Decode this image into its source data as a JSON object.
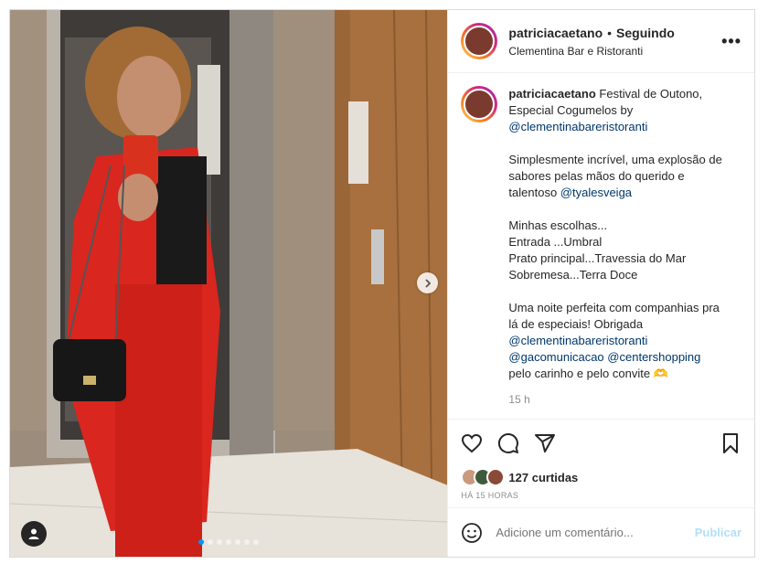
{
  "post": {
    "username": "patriciacaetano",
    "separator": "•",
    "follow_status": "Seguindo",
    "location": "Clementina Bar e Ristoranti",
    "caption": {
      "title": "Festival de Outono, Especial Cogumelos by",
      "mention1": "@clementinabareristoranti",
      "p2_text": "Simplesmente incrível, uma explosão de sabores pelas mãos do querido e talentoso",
      "p2_mention": "@tyalesveiga",
      "p3_line1": "Minhas escolhas...",
      "p3_line2": "Entrada ...Umbral",
      "p3_line3": "Prato principal...Travessia do Mar",
      "p3_line4": "Sobremesa...Terra Doce",
      "p4_text": "Uma noite perfeita com companhias pra lá de especiais! Obrigada",
      "p4_mention1": "@clementinabareristoranti",
      "p4_mention2": "@gacomunicacao",
      "p4_mention3": "@centershopping",
      "p4_end": "pelo carinho e pelo convite 🫶",
      "time": "15 h"
    },
    "likes_label": "127 curtidas",
    "posted_ago": "HÁ 15 HORAS",
    "comment_placeholder": "Adicione um comentário...",
    "publish_label": "Publicar",
    "carousel": {
      "count": 7,
      "active_index": 0
    },
    "colors": {
      "accent": "#0095f6",
      "link": "#00376b",
      "publish_disabled": "#b2dffc"
    },
    "icons": [
      "more-options-icon",
      "like-icon",
      "comment-icon",
      "share-icon",
      "save-icon",
      "emoji-icon",
      "next-arrow-icon",
      "user-tag-icon"
    ]
  }
}
